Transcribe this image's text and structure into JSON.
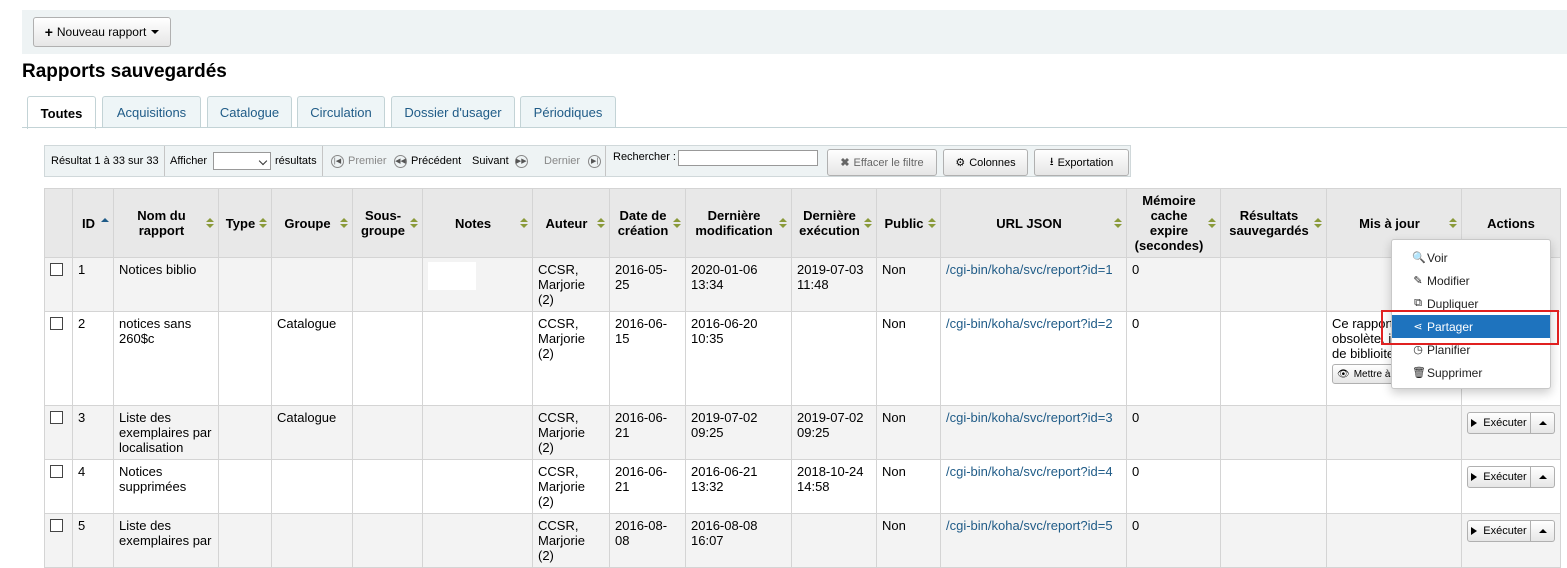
{
  "toolbar": {
    "new_report_label": "Nouveau rapport"
  },
  "page_title": "Rapports sauvegardés",
  "tabs": [
    {
      "label": "Toutes",
      "active": true
    },
    {
      "label": "Acquisitions"
    },
    {
      "label": "Catalogue"
    },
    {
      "label": "Circulation"
    },
    {
      "label": "Dossier d'usager"
    },
    {
      "label": "Périodiques"
    }
  ],
  "pager": {
    "info": "Résultat 1 à 33 sur 33",
    "show_label": "Afficher",
    "results_label": "résultats",
    "first": "Premier",
    "previous": "Précédent",
    "next": "Suivant",
    "last": "Dernier",
    "search_label": "Rechercher :"
  },
  "table_buttons": {
    "clear_filter": "Effacer le filtre",
    "columns": "Colonnes",
    "export": "Exportation"
  },
  "columns": [
    "ID",
    "Nom du rapport",
    "Type",
    "Groupe",
    "Sous-groupe",
    "Notes",
    "Auteur",
    "Date de création",
    "Dernière modification",
    "Dernière exécution",
    "Public",
    "URL JSON",
    "Mémoire cache expire (secondes)",
    "Résultats sauvegardés",
    "Mis à jour",
    "Actions"
  ],
  "rows": [
    {
      "id": "1",
      "name": "Notices biblio",
      "type": "",
      "group": "",
      "subgroup": "",
      "notes": "",
      "author": "CCSR, Marjorie (2)",
      "created": "2016-05-25",
      "modified": "2020-01-06 13:34",
      "run": "2019-07-03 11:48",
      "public": "Non",
      "url": "/cgi-bin/koha/svc/report?id=1",
      "cache": "0",
      "saved": "",
      "update": ""
    },
    {
      "id": "2",
      "name": "notices sans 260$c",
      "type": "",
      "group": "Catalogue",
      "subgroup": "",
      "notes": "",
      "author": "CCSR, Marjorie (2)",
      "created": "2016-06-15",
      "modified": "2016-06-20 10:35",
      "run": "",
      "public": "Non",
      "url": "/cgi-bin/koha/svc/report?id=2",
      "cache": "0",
      "saved": "",
      "update": "Ce rapport s obsolète, il champs de biblioitems.",
      "update_button": "Mettre à jo"
    },
    {
      "id": "3",
      "name": "Liste des exemplaires par localisation",
      "type": "",
      "group": "Catalogue",
      "subgroup": "",
      "notes": "",
      "author": "CCSR, Marjorie (2)",
      "created": "2016-06-21",
      "modified": "2019-07-02 09:25",
      "run": "2019-07-02 09:25",
      "public": "Non",
      "url": "/cgi-bin/koha/svc/report?id=3",
      "cache": "0",
      "saved": "",
      "update": ""
    },
    {
      "id": "4",
      "name": "Notices supprimées",
      "type": "",
      "group": "",
      "subgroup": "",
      "notes": "",
      "author": "CCSR, Marjorie (2)",
      "created": "2016-06-21",
      "modified": "2016-06-21 13:32",
      "run": "2018-10-24 14:58",
      "public": "Non",
      "url": "/cgi-bin/koha/svc/report?id=4",
      "cache": "0",
      "saved": "",
      "update": ""
    },
    {
      "id": "5",
      "name": "Liste des exemplaires par",
      "type": "",
      "group": "",
      "subgroup": "",
      "notes": "",
      "author": "CCSR, Marjorie (2)",
      "created": "2016-08-08",
      "modified": "2016-08-08 16:07",
      "run": "",
      "public": "Non",
      "url": "/cgi-bin/koha/svc/report?id=5",
      "cache": "0",
      "saved": "",
      "update": ""
    }
  ],
  "execute_label": "Exécuter",
  "action_menu": [
    {
      "label": "Voir",
      "icon": "search-icon"
    },
    {
      "label": "Modifier",
      "icon": "pencil-icon"
    },
    {
      "label": "Dupliquer",
      "icon": "copy-icon"
    },
    {
      "label": "Partager",
      "icon": "share-icon",
      "active": true
    },
    {
      "label": "Planifier",
      "icon": "clock-icon"
    },
    {
      "label": "Supprimer",
      "icon": "trash-icon"
    }
  ],
  "colors": {
    "link": "#1f5b87",
    "menu_active": "#1e73be",
    "highlight": "#e02020"
  }
}
